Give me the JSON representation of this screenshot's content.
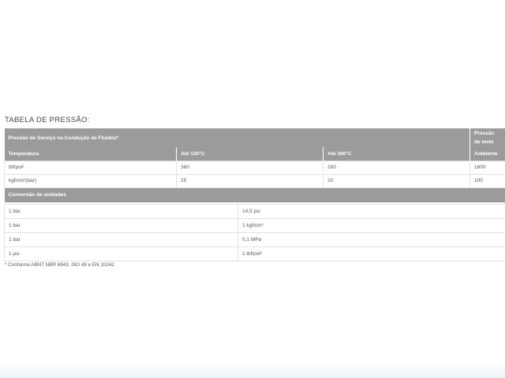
{
  "title": "TABELA DE PRESSÃO:",
  "pressure_table": {
    "header_main": "Pressão de Serviço na Condução de Fluídos*",
    "header_test_line1": "Pressão",
    "header_test_line2": "de teste",
    "columns": [
      "Temperatura",
      "Até 120°C",
      "Até 300°C",
      "Ambiente"
    ],
    "rows": [
      [
        "lbf/pol²",
        "360",
        "290",
        "1600"
      ],
      [
        "kgf/cm²(bar)",
        "25",
        "20",
        "100"
      ]
    ]
  },
  "conversion_table": {
    "header": "Conversão de unidades",
    "rows": [
      [
        "1 bar",
        "14,5 psi"
      ],
      [
        "1 bar",
        "1 kgf/cm²"
      ],
      [
        "1 bar",
        "0,1 MPa"
      ],
      [
        "1 psi",
        "1 lbf/pol²"
      ]
    ]
  },
  "footnote": "* Conforme ABNT NBR 6943, ISO 49 e EN 10242"
}
